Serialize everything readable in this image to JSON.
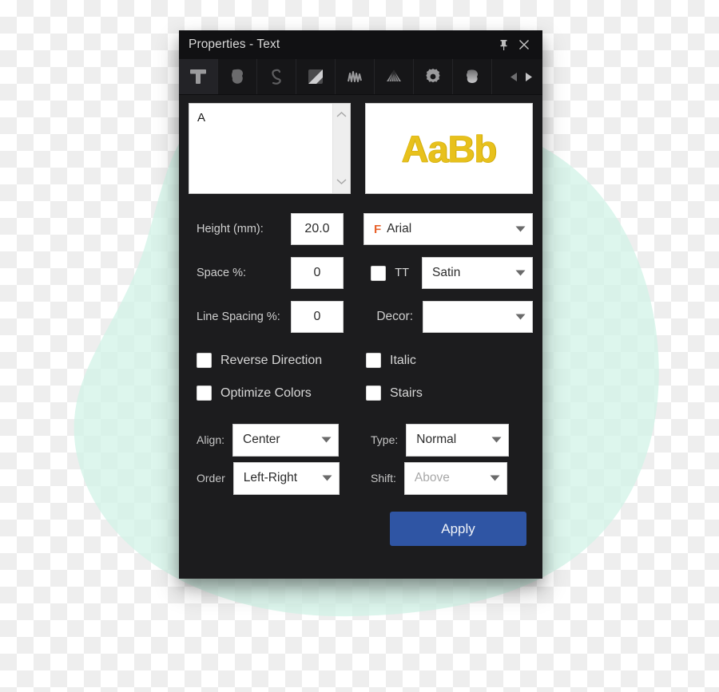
{
  "window": {
    "title": "Properties - Text",
    "pin_icon": "pin-icon",
    "close_icon": "close-icon"
  },
  "tabs": [
    {
      "id": "text",
      "icon": "letter-t-icon",
      "active": true
    },
    {
      "id": "fill",
      "icon": "blob-fill-icon",
      "active": false
    },
    {
      "id": "outline",
      "icon": "curve-s-icon",
      "active": false
    },
    {
      "id": "gradient",
      "icon": "square-fold-icon",
      "active": false
    },
    {
      "id": "zigzag",
      "icon": "zigzag-icon",
      "active": false
    },
    {
      "id": "fan",
      "icon": "fan-stitch-icon",
      "active": false
    },
    {
      "id": "settings",
      "icon": "gear-icon",
      "active": false
    },
    {
      "id": "shape",
      "icon": "blob-shape-icon",
      "active": false
    }
  ],
  "tab_nav": {
    "prev_icon": "triangle-left-icon",
    "next_icon": "triangle-right-icon"
  },
  "editor": {
    "text_value": "A",
    "scroll_up_icon": "chevron-up-icon",
    "scroll_down_icon": "chevron-down-icon"
  },
  "preview": {
    "sample_text": "AaBb",
    "color": "#e8c11c"
  },
  "fields": {
    "height_label": "Height (mm):",
    "height_value": "20.0",
    "space_label": "Space %:",
    "space_value": "0",
    "line_spacing_label": "Line Spacing %:",
    "line_spacing_value": "0",
    "font_tag": "F",
    "font_value": "Arial",
    "tt_label": "TT",
    "tt_checked": false,
    "stitch_value": "Satin",
    "decor_label": "Decor:",
    "decor_value": ""
  },
  "checkboxes": [
    {
      "label": "Reverse Direction",
      "checked": false
    },
    {
      "label": "Italic",
      "checked": false
    },
    {
      "label": "Optimize Colors",
      "checked": false
    },
    {
      "label": "Stairs",
      "checked": false
    }
  ],
  "selects": {
    "align_label": "Align:",
    "align_value": "Center",
    "type_label": "Type:",
    "type_value": "Normal",
    "order_label": "Order",
    "order_value": "Left-Right",
    "shift_label": "Shift:",
    "shift_value": "Above",
    "shift_disabled": true
  },
  "actions": {
    "apply_label": "Apply",
    "apply_color": "#2f55a4"
  },
  "background": {
    "blob_color": "#d3f3e8",
    "checker_color": "#eeeeee"
  }
}
